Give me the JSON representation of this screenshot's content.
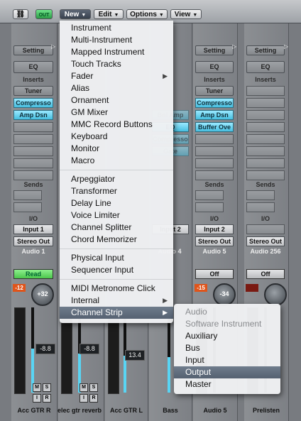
{
  "toolbar": {
    "link_label": "link",
    "midi_out_label": "OUT",
    "menus": [
      "New",
      "Edit",
      "Options",
      "View"
    ]
  },
  "new_menu": {
    "items": [
      {
        "label": "Instrument"
      },
      {
        "label": "Multi-Instrument"
      },
      {
        "label": "Mapped Instrument"
      },
      {
        "label": "Touch Tracks"
      },
      {
        "label": "Fader"
      },
      {
        "label": "Alias"
      },
      {
        "label": "Ornament"
      },
      {
        "label": "GM Mixer"
      },
      {
        "label": "MMC Record Buttons"
      },
      {
        "label": "Keyboard"
      },
      {
        "label": "Monitor"
      },
      {
        "label": "Macro"
      },
      {
        "label": "Arpeggiator"
      },
      {
        "label": "Transformer"
      },
      {
        "label": "Delay Line"
      },
      {
        "label": "Voice Limiter"
      },
      {
        "label": "Channel Splitter"
      },
      {
        "label": "Chord Memorizer"
      },
      {
        "label": "Physical Input"
      },
      {
        "label": "Sequencer Input"
      },
      {
        "label": "MIDI Metronome Click"
      },
      {
        "label": "Internal"
      },
      {
        "label": "Channel Strip"
      }
    ],
    "highlighted": "Channel Strip"
  },
  "channel_strip_submenu": {
    "items": [
      {
        "label": "Audio",
        "enabled": false
      },
      {
        "label": "Software Instrument",
        "enabled": false
      },
      {
        "label": "Auxiliary",
        "enabled": true
      },
      {
        "label": "Bus",
        "enabled": true
      },
      {
        "label": "Input",
        "enabled": true
      },
      {
        "label": "Output",
        "enabled": true
      },
      {
        "label": "Master",
        "enabled": true
      }
    ],
    "highlighted": "Output"
  },
  "strip_common": {
    "setting": "Setting",
    "eq": "EQ",
    "inserts": "Inserts",
    "sends": "Sends",
    "io": "I/O",
    "tuner": "Tuner",
    "m": "M",
    "s": "S",
    "i": "I",
    "r": "R"
  },
  "strips": [
    {
      "name": "Acc GTR R",
      "channel": "Audio 1",
      "input": "Input 1",
      "output": "Stereo Out",
      "automation": "Read",
      "pan": "+32",
      "volume": "-8.8",
      "peak": "-12",
      "plugins": [
        "Compresso",
        "Amp Dsn"
      ]
    },
    {
      "name": "elec gtr reverb",
      "volume": "-8.8"
    },
    {
      "name": "Acc GTR L",
      "volume": "13.4"
    },
    {
      "name": "Bass",
      "channel": "Audio 4",
      "input": "Input 2",
      "plugins": [
        "Bnl Amp",
        "EQ",
        "Compresso",
        "Gate"
      ]
    },
    {
      "name": "Audio 5",
      "channel": "Audio 5",
      "input": "Input 2",
      "output": "Stereo Out",
      "automation": "Off",
      "pan": "-34",
      "peak": "-15",
      "plugins": [
        "Compresso",
        "Amp Dsn",
        "Buffer Ove"
      ]
    },
    {
      "name": "Prelisten",
      "channel": "Audio 256",
      "output": "Stereo Out",
      "automation": "Off"
    }
  ],
  "colors": {
    "accent": "#59d5f4",
    "read_green": "#5ed15f",
    "highlight": "#5e6a7a"
  }
}
